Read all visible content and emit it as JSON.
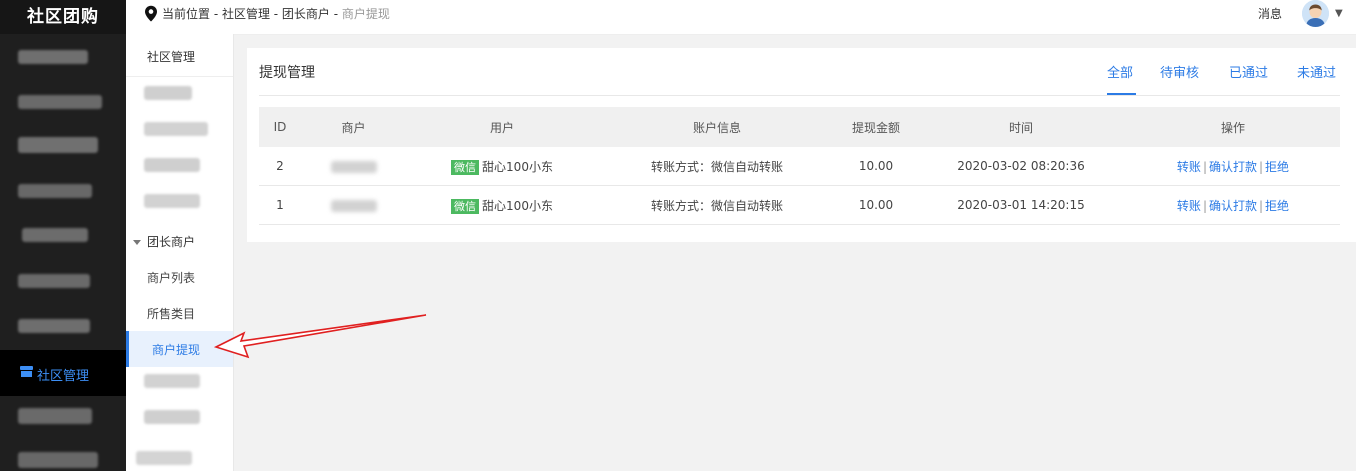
{
  "app": {
    "logo": "社区团购"
  },
  "sidebar": {
    "active_item": {
      "label": "社区管理",
      "icon": "shop-icon"
    }
  },
  "subnav": {
    "title": "社区管理",
    "group": "团长商户",
    "links": [
      "商户列表",
      "所售类目"
    ],
    "active": "商户提现"
  },
  "topbar": {
    "breadcrumb": {
      "prefix": "当前位置 - 社区管理 - 团长商户 - ",
      "current": "商户提现"
    },
    "message": "消息"
  },
  "panel": {
    "title": "提现管理",
    "tabs": [
      "全部",
      "待审核",
      "已通过",
      "未通过"
    ],
    "active_tab": "全部"
  },
  "table": {
    "headers": [
      "ID",
      "商户",
      "用户",
      "账户信息",
      "提现金额",
      "时间",
      "操作"
    ],
    "rows": [
      {
        "id": "2",
        "user_tag": "微信",
        "user": "甜心100小东",
        "account": "转账方式：微信自动转账",
        "amount": "10.00",
        "time": "2020-03-02 08:20:36"
      },
      {
        "id": "1",
        "user_tag": "微信",
        "user": "甜心100小东",
        "account": "转账方式：微信自动转账",
        "amount": "10.00",
        "time": "2020-03-01 14:20:15"
      }
    ],
    "actions": [
      "转账",
      "确认打款",
      "拒绝"
    ],
    "action_sep": "|"
  },
  "colors": {
    "accent": "#2c7be5",
    "sidebar_bg": "#1f1f1f",
    "wechat_tag": "#4cb960"
  }
}
